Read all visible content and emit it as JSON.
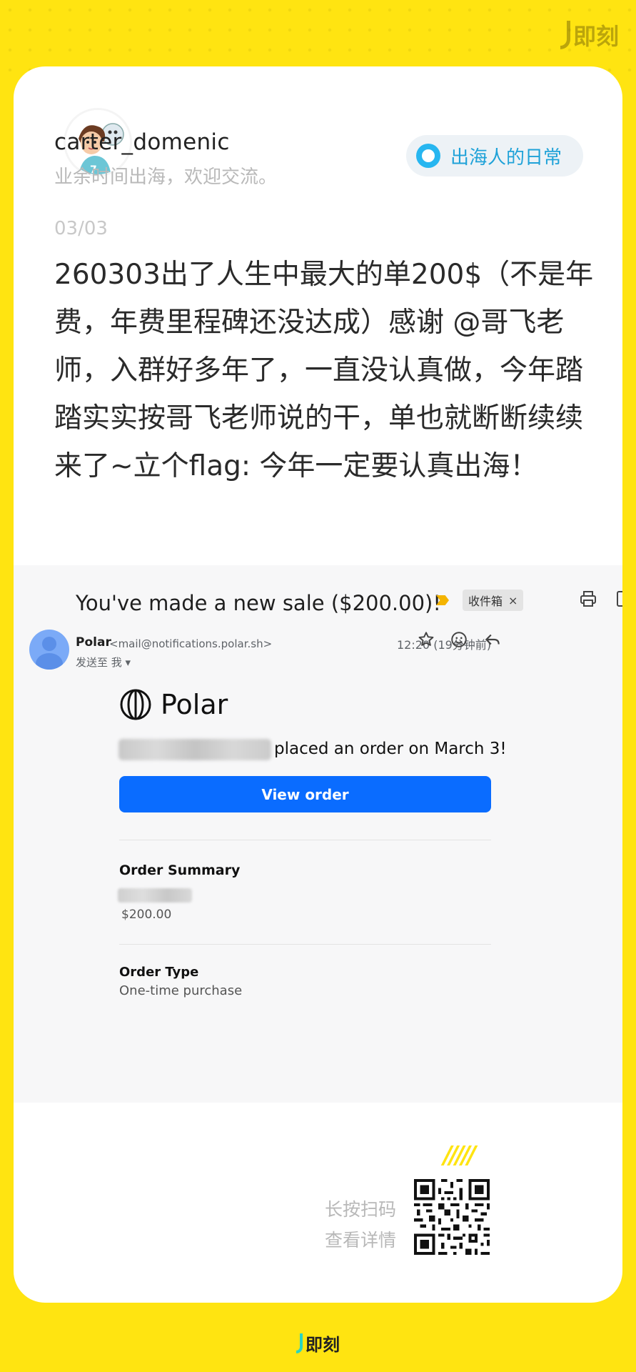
{
  "brand": {
    "name": "即刻"
  },
  "user": {
    "username": "carter_domenic",
    "bio": "业余时间出海，欢迎交流。"
  },
  "topic": {
    "label": "出海人的日常"
  },
  "post": {
    "date": "03/03",
    "text": "260303出了人生中最大的单200$（不是年费，年费里程碑还没达成）感谢 @哥飞老师，入群好多年了，一直没认真做，今年踏踏实实按哥飞老师说的干，单也就断断续续来了~立个flag: 今年一定要认真出海！"
  },
  "email": {
    "subject": "You've made a new sale ($200.00)!",
    "inbox_chip": "收件箱",
    "chip_close": "×",
    "sender_name": "Polar",
    "sender_address": "<mail@notifications.polar.sh>",
    "send_to": "发送至 我 ▾",
    "time": "12:20 (19分钟前)",
    "logo_text": "Polar",
    "placed_text": "placed an order on March 3!",
    "view_order_label": "View order",
    "order_summary_title": "Order Summary",
    "price": "$200.00",
    "order_type_title": "Order Type",
    "order_type_value": "One-time purchase",
    "icons": [
      "print-icon",
      "new-window-icon",
      "star-icon",
      "emoji-icon",
      "reply-icon"
    ]
  },
  "footer": {
    "stripes": "/////",
    "line1": "长按扫码",
    "line2": "查看详情"
  },
  "colors": {
    "background": "#FFE411",
    "topic_accent": "#27B6F0",
    "button": "#0A6CFF"
  }
}
